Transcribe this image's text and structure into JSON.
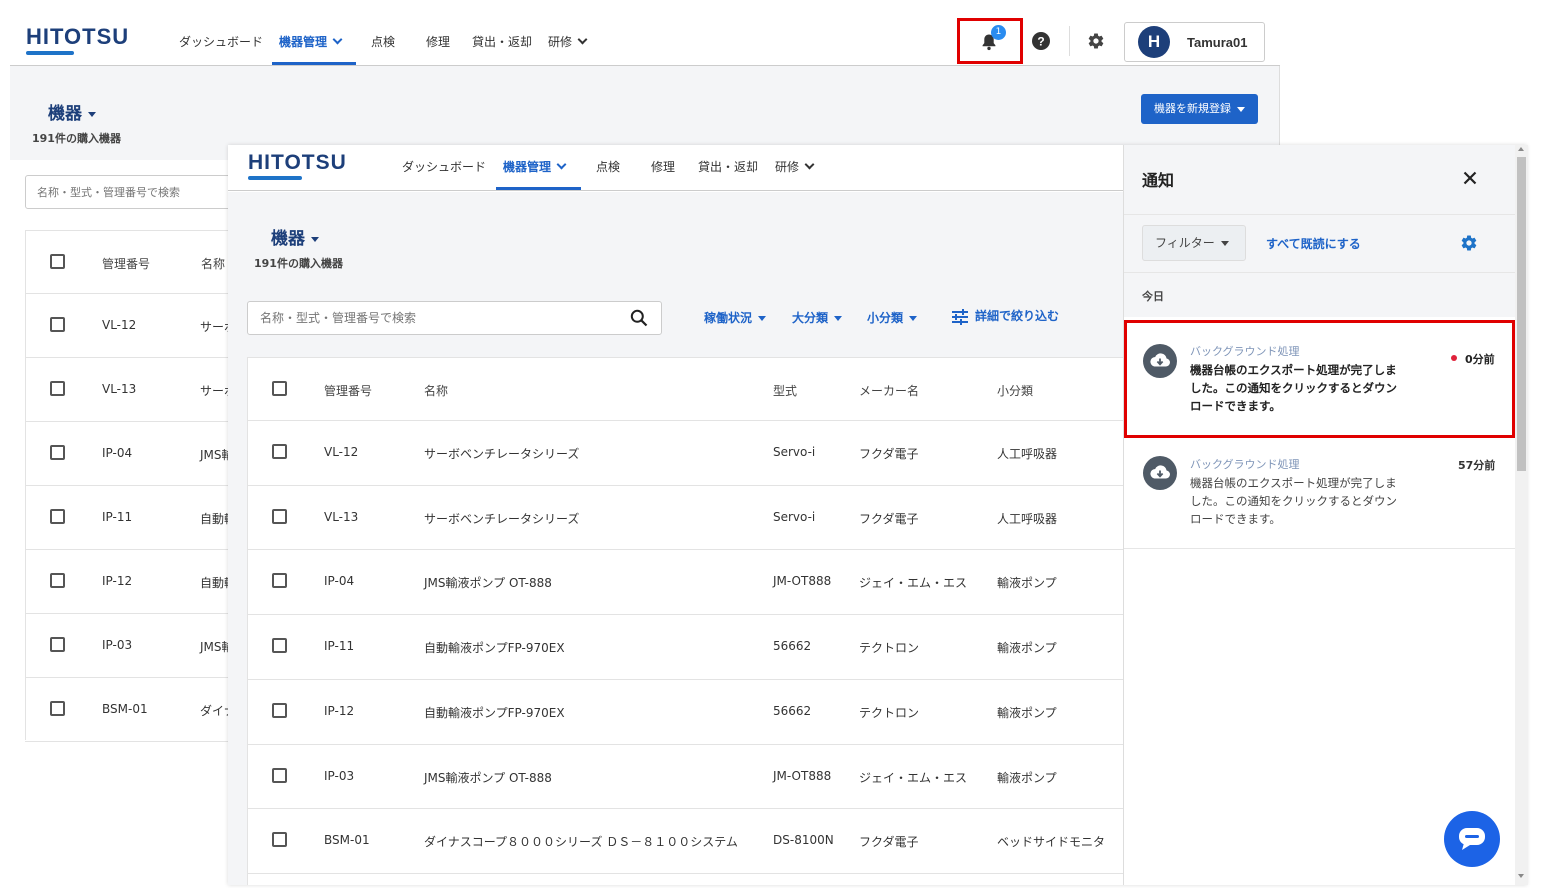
{
  "bg_app": {
    "logo": "HITOTSU",
    "nav": {
      "dashboard": "ダッシュボード",
      "equipment": "機器管理",
      "inspection": "点検",
      "repair": "修理",
      "lending": "貸出・返却",
      "training": "研修"
    },
    "notif_count": "1",
    "user_initial": "H",
    "user_name": "Tamura01",
    "page_title": "機器",
    "page_subtitle": "191件の購入機器",
    "register_button": "機器を新規登録",
    "search_placeholder": "名称・型式・管理番号で検索",
    "headers": {
      "id": "管理番号",
      "name": "名称"
    },
    "rows": [
      {
        "id": "VL-12",
        "name": "サーボ"
      },
      {
        "id": "VL-13",
        "name": "サーボ"
      },
      {
        "id": "IP-04",
        "name": "JMS輸"
      },
      {
        "id": "IP-11",
        "name": "自動輸"
      },
      {
        "id": "IP-12",
        "name": "自動輸"
      },
      {
        "id": "IP-03",
        "name": "JMS輸"
      },
      {
        "id": "BSM-01",
        "name": "ダイナ"
      }
    ]
  },
  "fg_app": {
    "logo": "HITOTSU",
    "nav": {
      "dashboard": "ダッシュボード",
      "equipment": "機器管理",
      "inspection": "点検",
      "repair": "修理",
      "lending": "貸出・返却",
      "training": "研修"
    },
    "page_title": "機器",
    "page_subtitle": "191件の購入機器",
    "search_placeholder": "名称・型式・管理番号で検索",
    "filters": {
      "status": "稼働状況",
      "major": "大分類",
      "minor": "小分類",
      "detail": "詳細で絞り込む"
    },
    "headers": {
      "id": "管理番号",
      "name": "名称",
      "model": "型式",
      "maker": "メーカー名",
      "subcategory": "小分類"
    },
    "rows": [
      {
        "id": "VL-12",
        "name": "サーボベンチレータシリーズ",
        "model": "Servo-i",
        "maker": "フクダ電子",
        "sub": "人工呼吸器"
      },
      {
        "id": "VL-13",
        "name": "サーボベンチレータシリーズ",
        "model": "Servo-i",
        "maker": "フクダ電子",
        "sub": "人工呼吸器"
      },
      {
        "id": "IP-04",
        "name": "JMS輸液ポンプ OT-888",
        "model": "JM-OT888",
        "maker": "ジェイ・エム・エス",
        "sub": "輸液ポンプ"
      },
      {
        "id": "IP-11",
        "name": "自動輸液ポンプFP-970EX",
        "model": "56662",
        "maker": "テクトロン",
        "sub": "輸液ポンプ"
      },
      {
        "id": "IP-12",
        "name": "自動輸液ポンプFP-970EX",
        "model": "56662",
        "maker": "テクトロン",
        "sub": "輸液ポンプ"
      },
      {
        "id": "IP-03",
        "name": "JMS輸液ポンプ OT-888",
        "model": "JM-OT888",
        "maker": "ジェイ・エム・エス",
        "sub": "輸液ポンプ"
      },
      {
        "id": "BSM-01",
        "name": "ダイナスコープ８０００シリーズ ＤＳ－８１００システム",
        "model": "DS-8100N",
        "maker": "フクダ電子",
        "sub": "ベッドサイドモニタ"
      }
    ]
  },
  "notifications": {
    "title": "通知",
    "filter_label": "フィルター",
    "mark_all_read": "すべて既読にする",
    "section_today": "今日",
    "items": [
      {
        "category": "バックグラウンド処理",
        "message": "機器台帳のエクスポート処理が完了しました。この通知をクリックするとダウンロードできます。",
        "time": "0分前",
        "unread": true
      },
      {
        "category": "バックグラウンド処理",
        "message": "機器台帳のエクスポート処理が完了しました。この通知をクリックするとダウンロードできます。",
        "time": "57分前",
        "unread": false
      }
    ]
  },
  "colors": {
    "primary": "#1e63c8",
    "highlight": "#e00000",
    "logo": "#1d3f7a",
    "unread_dot": "#e0223a"
  }
}
